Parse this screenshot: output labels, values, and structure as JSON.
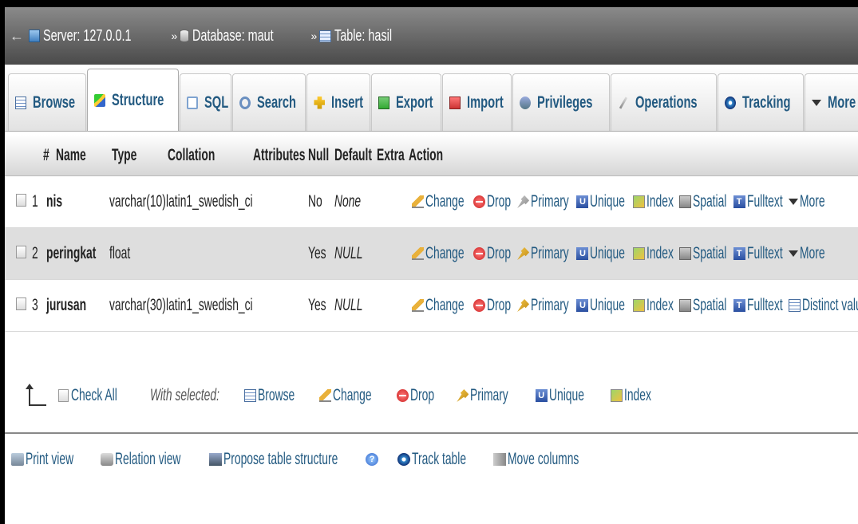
{
  "breadcrumb": {
    "back": "←",
    "server": "Server: 127.0.0.1",
    "database": "Database: maut",
    "table": "Table: hasil",
    "separator": "»"
  },
  "tabs": [
    {
      "label": "Browse",
      "icon": "browse-icon"
    },
    {
      "label": "Structure",
      "icon": "structure-icon",
      "active": true
    },
    {
      "label": "SQL",
      "icon": "sql-icon"
    },
    {
      "label": "Search",
      "icon": "search-icon"
    },
    {
      "label": "Insert",
      "icon": "insert-icon"
    },
    {
      "label": "Export",
      "icon": "export-icon"
    },
    {
      "label": "Import",
      "icon": "import-icon"
    },
    {
      "label": "Privileges",
      "icon": "privileges-icon"
    },
    {
      "label": "Operations",
      "icon": "operations-icon"
    },
    {
      "label": "Tracking",
      "icon": "tracking-icon"
    },
    {
      "label": "More",
      "icon": "chevron-down-icon"
    }
  ],
  "table_headers": {
    "num": "#",
    "name": "Name",
    "type": "Type",
    "collation": "Collation",
    "attributes": "Attributes",
    "null": "Null",
    "default": "Default",
    "extra": "Extra",
    "action": "Action"
  },
  "rows": [
    {
      "num": "1",
      "name": "nis",
      "type": "varchar(10)",
      "collation": "latin1_swedish_ci",
      "null": "No",
      "default": "None",
      "last_action": "More"
    },
    {
      "num": "2",
      "name": "peringkat",
      "type": "float",
      "collation": "",
      "null": "Yes",
      "default": "NULL",
      "last_action": "More"
    },
    {
      "num": "3",
      "name": "jurusan",
      "type": "varchar(30)",
      "collation": "latin1_swedish_ci",
      "null": "Yes",
      "default": "NULL",
      "last_action": "Distinct values"
    }
  ],
  "actions": {
    "change": "Change",
    "drop": "Drop",
    "primary": "Primary",
    "unique": "Unique",
    "index": "Index",
    "spatial": "Spatial",
    "fulltext": "Fulltext"
  },
  "selection": {
    "check_all": "Check All",
    "with_selected": "With selected:",
    "browse": "Browse",
    "change": "Change",
    "drop": "Drop",
    "primary": "Primary",
    "unique": "Unique",
    "index": "Index"
  },
  "footer": {
    "print_view": "Print view",
    "relation_view": "Relation view",
    "propose": "Propose table structure",
    "track_table": "Track table",
    "move_columns": "Move columns"
  },
  "colors": {
    "link": "#235a81",
    "row_alt": "#dedede",
    "crumb_bg": "#5a5a5a"
  }
}
